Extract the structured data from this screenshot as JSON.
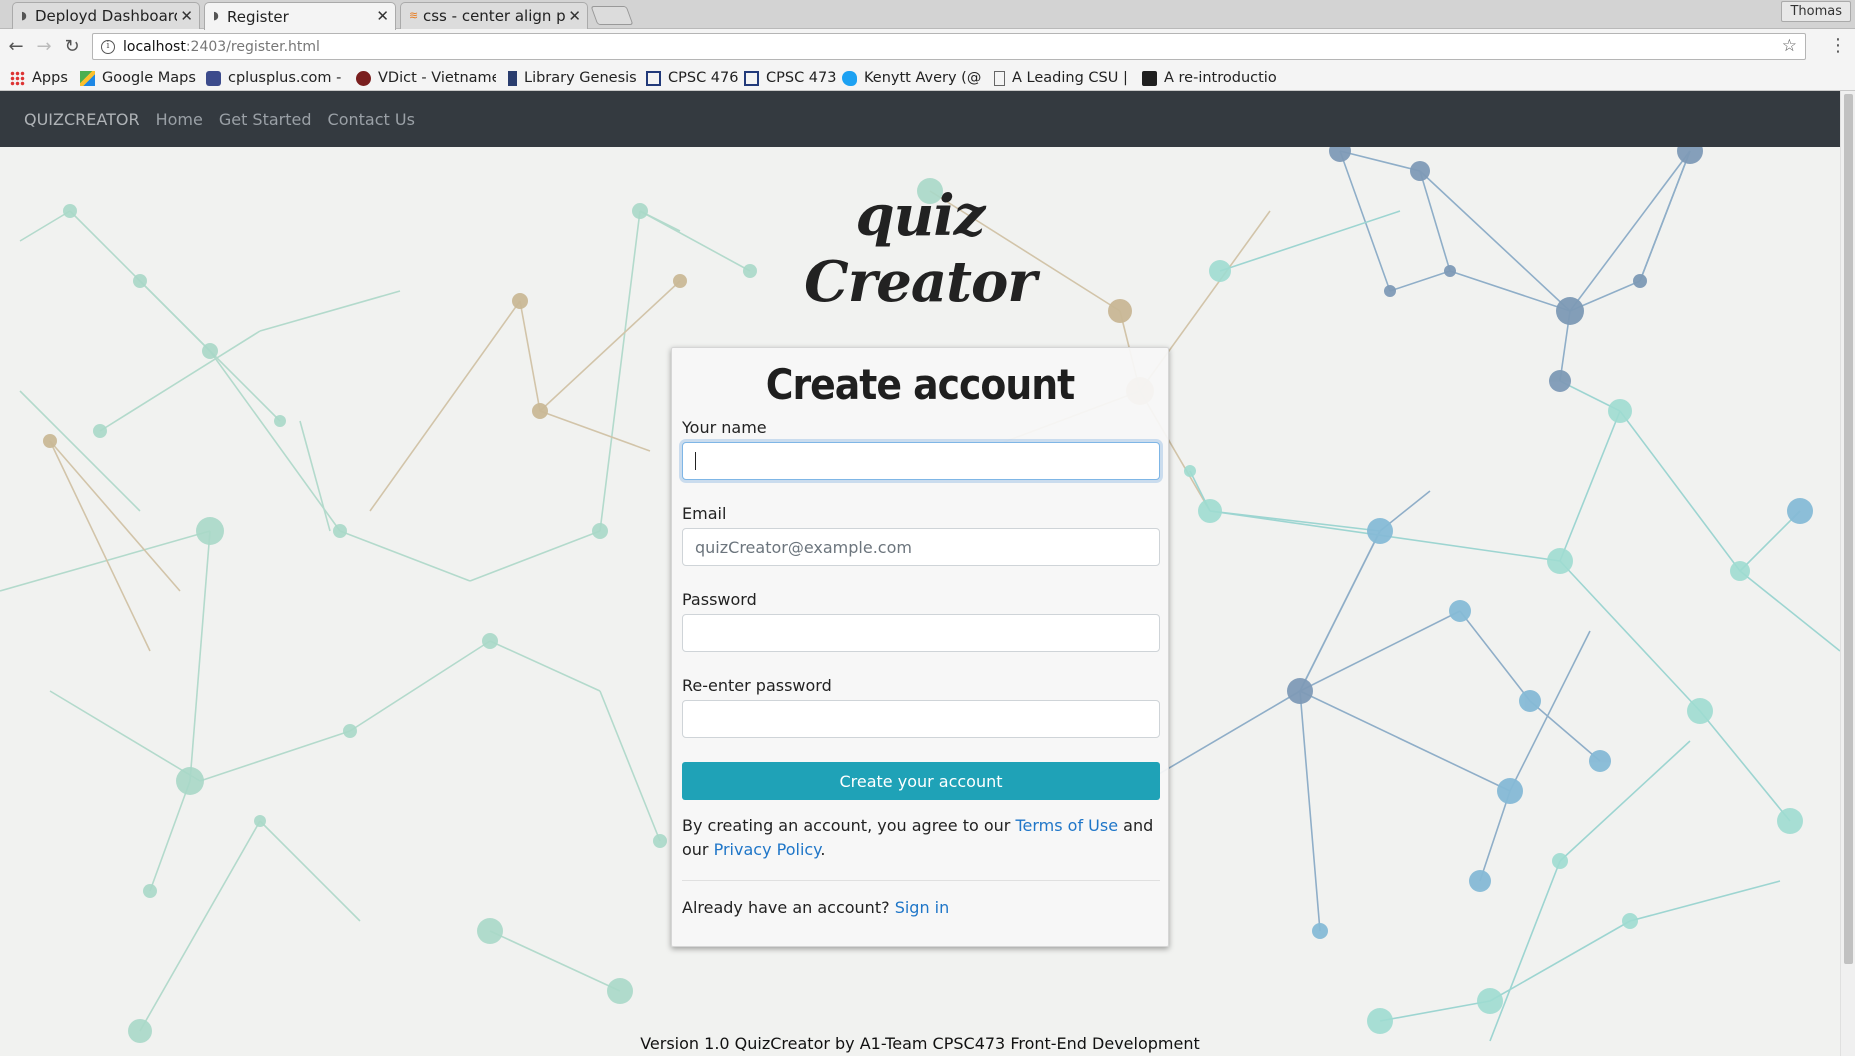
{
  "browser": {
    "tabs": [
      {
        "label": "Deployd Dashboard",
        "active": false
      },
      {
        "label": "Register",
        "active": true
      },
      {
        "label": "css - center align po",
        "active": false
      }
    ],
    "profile_name": "Thomas",
    "url_host": "localhost",
    "url_path": ":2403/register.html",
    "bookmarks": [
      {
        "label": "Apps",
        "icon": "apps-grid-icon"
      },
      {
        "label": "Google Maps",
        "icon": "maps-icon"
      },
      {
        "label": "cplusplus.com -",
        "icon": "cplusplus-icon"
      },
      {
        "label": "VDict - Vietname",
        "icon": "vdict-icon"
      },
      {
        "label": "Library Genesis",
        "icon": "library-icon"
      },
      {
        "label": "CPSC 476",
        "icon": "calendar-icon"
      },
      {
        "label": "CPSC 473",
        "icon": "calendar-icon"
      },
      {
        "label": "Kenytt Avery (@",
        "icon": "twitter-icon"
      },
      {
        "label": "A Leading CSU |",
        "icon": "page-icon"
      },
      {
        "label": "A re-introductio",
        "icon": "mdn-icon"
      }
    ]
  },
  "site": {
    "nav": {
      "brand": "QUIZCREATOR",
      "links": [
        "Home",
        "Get Started",
        "Contact Us"
      ]
    },
    "logo_text": "quiz Creator",
    "form": {
      "title": "Create account",
      "name_label": "Your name",
      "email_label": "Email",
      "email_placeholder": "quizCreator@example.com",
      "password_label": "Password",
      "repassword_label": "Re-enter password",
      "submit_label": "Create your account",
      "terms_prefix": "By creating an account, you agree to our",
      "terms_link": "Terms of Use",
      "terms_mid": "and our",
      "privacy_link": "Privacy Policy",
      "terms_suffix": ".",
      "signin_prompt": "Already have an account?",
      "signin_link": "Sign in"
    },
    "footer": "Version 1.0 QuizCreator by A1-Team CPSC473 Front-End Development"
  },
  "colors": {
    "nav_bg": "#343a40",
    "accent_button": "#1fa2b7",
    "link": "#1f76c8"
  }
}
